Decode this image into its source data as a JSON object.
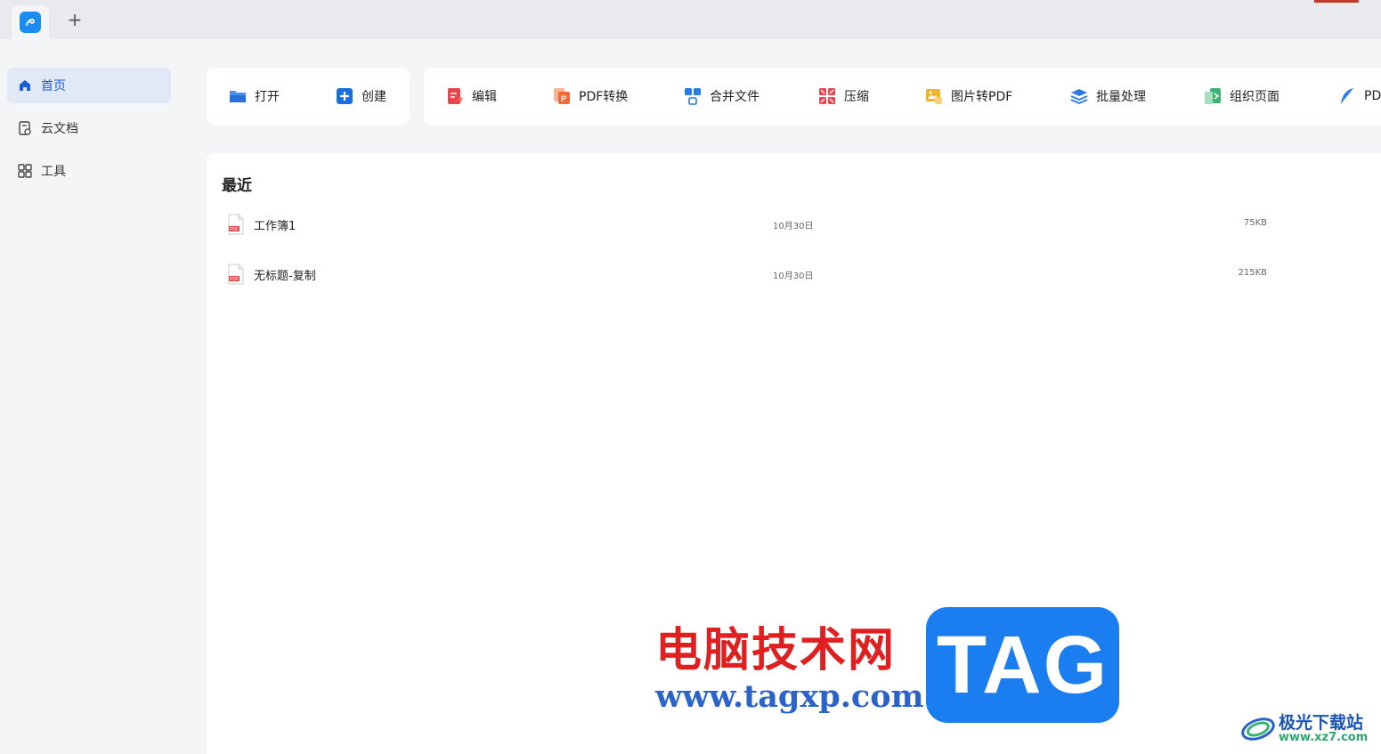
{
  "titlebar": {
    "new_tab_symbol": "+"
  },
  "sidebar": {
    "items": [
      {
        "label": "首页",
        "icon": "home-icon",
        "active": true
      },
      {
        "label": "云文档",
        "icon": "cloud-doc-icon",
        "active": false
      },
      {
        "label": "工具",
        "icon": "tools-grid-icon",
        "active": false
      }
    ]
  },
  "toolbar": {
    "open_label": "打开",
    "create_label": "创建",
    "tools": [
      {
        "label": "编辑",
        "icon": "edit-icon",
        "color": "#e8464a"
      },
      {
        "label": "PDF转换",
        "icon": "pdf-convert-icon",
        "color": "#f06a35"
      },
      {
        "label": "合并文件",
        "icon": "merge-icon",
        "color": "#2a7ae8"
      },
      {
        "label": "压缩",
        "icon": "compress-icon",
        "color": "#e8464a"
      },
      {
        "label": "图片转PDF",
        "icon": "image-to-pdf-icon",
        "color": "#f0b32a"
      },
      {
        "label": "批量处理",
        "icon": "batch-layers-icon",
        "color": "#2a7ae8"
      },
      {
        "label": "组织页面",
        "icon": "organize-pages-icon",
        "color": "#3cb371"
      },
      {
        "label": "PD",
        "icon": "pdf-feather-icon",
        "color": "#2a7ae8"
      }
    ]
  },
  "recent": {
    "title": "最近",
    "files": [
      {
        "name": "工作簿1",
        "date": "10月30日",
        "size": "75KB"
      },
      {
        "name": "无标题-复制",
        "date": "10月30日",
        "size": "215KB"
      }
    ]
  },
  "watermark": {
    "site_cn": "电脑技术网",
    "site_url": "www.tagxp.com",
    "tag": "TAG",
    "xz_name": "极光下载站",
    "xz_url": "www.xz7.com"
  },
  "colors": {
    "accent": "#1a5fd6",
    "active_bg": "#e1e9f7",
    "app_logo": "#1a8bf0"
  }
}
